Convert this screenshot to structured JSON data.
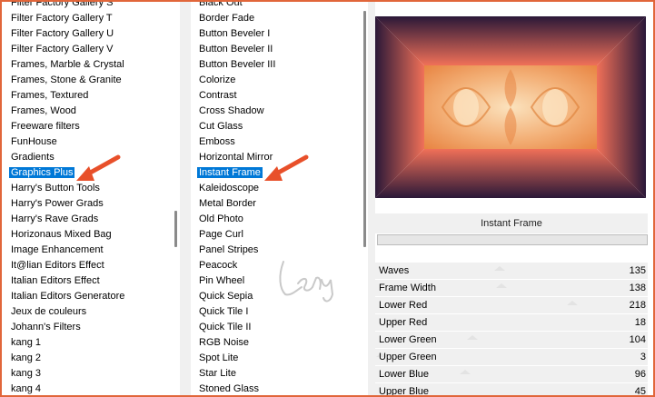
{
  "category_list": {
    "items": [
      "Filter Factory Gallery S",
      "Filter Factory Gallery T",
      "Filter Factory Gallery U",
      "Filter Factory Gallery V",
      "Frames, Marble & Crystal",
      "Frames, Stone & Granite",
      "Frames, Textured",
      "Frames, Wood",
      "Freeware filters",
      "FunHouse",
      "Gradients",
      "Graphics Plus",
      "Harry's Button Tools",
      "Harry's Power Grads",
      "Harry's Rave Grads",
      "Horizonaus Mixed Bag",
      "Image Enhancement",
      "It@lian Editors Effect",
      "Italian Editors Effect",
      "Italian Editors Generatore",
      "Jeux de couleurs",
      "Johann's Filters",
      "kang 1",
      "kang 2",
      "kang 3",
      "kang 4"
    ],
    "selected": "Graphics Plus"
  },
  "filter_list": {
    "items": [
      "Black Out",
      "Border Fade",
      "Button Beveler I",
      "Button Beveler II",
      "Button Beveler III",
      "Colorize",
      "Contrast",
      "Cross Shadow",
      "Cut Glass",
      "Emboss",
      "Horizontal Mirror",
      "Instant Frame",
      "Kaleidoscope",
      "Metal Border",
      "Old Photo",
      "Page Curl",
      "Panel Stripes",
      "Peacock",
      "Pin Wheel",
      "Quick Sepia",
      "Quick Tile I",
      "Quick Tile II",
      "RGB Noise",
      "Spot Lite",
      "Star Lite",
      "Stoned Glass"
    ],
    "selected": "Instant Frame"
  },
  "filter_title": "Instant Frame",
  "watermark": "Leny",
  "sliders": [
    {
      "label": "Waves",
      "value": "135",
      "level": 0.53
    },
    {
      "label": "Frame Width",
      "value": "138",
      "level": 0.54
    },
    {
      "label": "Lower Red",
      "value": "218",
      "level": 0.85
    },
    {
      "label": "Upper Red",
      "value": "18",
      "level": 0.07
    },
    {
      "label": "Lower Green",
      "value": "104",
      "level": 0.41
    },
    {
      "label": "Upper Green",
      "value": "3",
      "level": 0.01
    },
    {
      "label": "Lower Blue",
      "value": "96",
      "level": 0.38
    },
    {
      "label": "Upper Blue",
      "value": "45",
      "level": 0.18
    }
  ],
  "colors": {
    "border": "#e1663a",
    "selection": "#0078d7",
    "arrow": "#e8502a",
    "frame_dark": "#2a1838",
    "frame_light": "#f07058"
  },
  "icons": {
    "pointer": "arrow-icon"
  }
}
